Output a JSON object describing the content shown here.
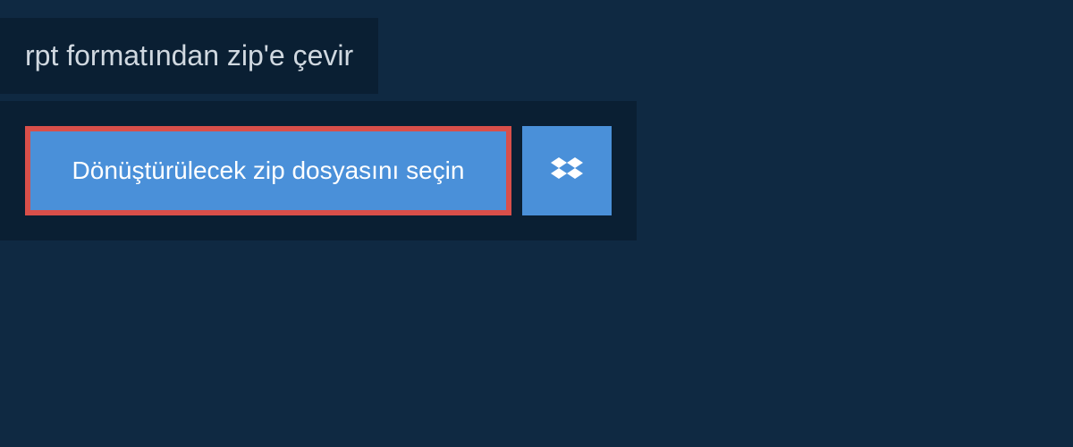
{
  "header": {
    "title": "rpt formatından zip'e çevir"
  },
  "upload": {
    "select_button_label": "Dönüştürülecek zip dosyasını seçin"
  },
  "colors": {
    "background": "#0f2942",
    "panel": "#0a1f33",
    "button_primary": "#4a90d9",
    "button_border": "#d94f4a",
    "text_light": "#ffffff",
    "text_header": "#d0d8e0"
  }
}
